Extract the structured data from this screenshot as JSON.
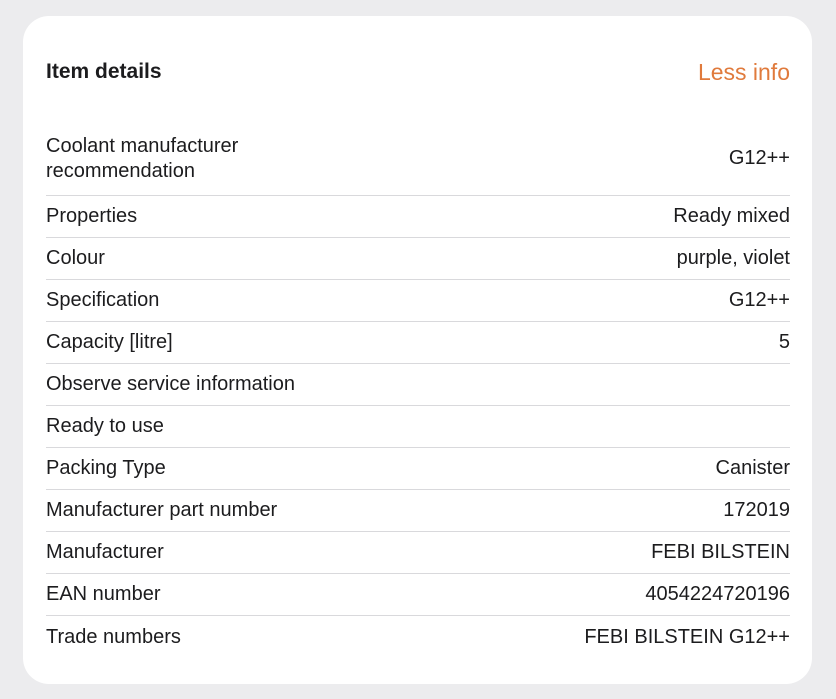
{
  "header": {
    "title": "Item details",
    "toggle_label": "Less info"
  },
  "rows": [
    {
      "label": "Coolant manufacturer recommendation",
      "value": "G12++"
    },
    {
      "label": "Properties",
      "value": "Ready mixed"
    },
    {
      "label": "Colour",
      "value": "purple, violet"
    },
    {
      "label": "Specification",
      "value": "G12++"
    },
    {
      "label": "Capacity [litre]",
      "value": "5"
    },
    {
      "label": "Observe service information",
      "value": ""
    },
    {
      "label": "Ready to use",
      "value": ""
    },
    {
      "label": "Packing Type",
      "value": "Canister"
    },
    {
      "label": "Manufacturer part number",
      "value": "172019"
    },
    {
      "label": "Manufacturer",
      "value": "FEBI BILSTEIN"
    },
    {
      "label": "EAN number",
      "value": "4054224720196"
    },
    {
      "label": "Trade numbers",
      "value": "FEBI BILSTEIN G12++"
    }
  ]
}
